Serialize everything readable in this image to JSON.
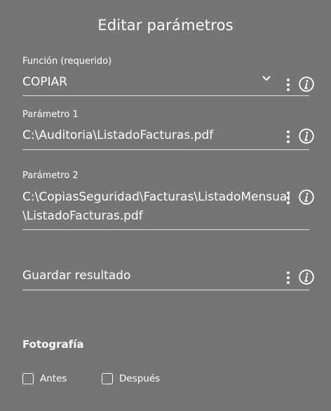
{
  "dialog": {
    "title": "Editar parámetros"
  },
  "fields": {
    "function": {
      "label": "Función (requerido)",
      "value": "COPIAR"
    },
    "param1": {
      "label": "Parámetro 1",
      "value": "C:\\Auditoria\\ListadoFacturas.pdf"
    },
    "param2": {
      "label": "Parámetro 2",
      "value": "C:\\CopiasSeguridad\\Facturas\\ListadoMensual\\ListadoFacturas.pdf"
    },
    "save_result": {
      "placeholder": "Guardar resultado"
    }
  },
  "photo": {
    "title": "Fotografía",
    "options": [
      {
        "label": "Antes",
        "checked": false
      },
      {
        "label": "Después",
        "checked": false
      }
    ]
  },
  "icons": {
    "more": "more-vertical-icon",
    "info": "info-icon",
    "dropdown": "chevron-down-icon"
  },
  "colors": {
    "background": "#757575",
    "text": "#ffffff",
    "underline": "#e6e6e6"
  }
}
